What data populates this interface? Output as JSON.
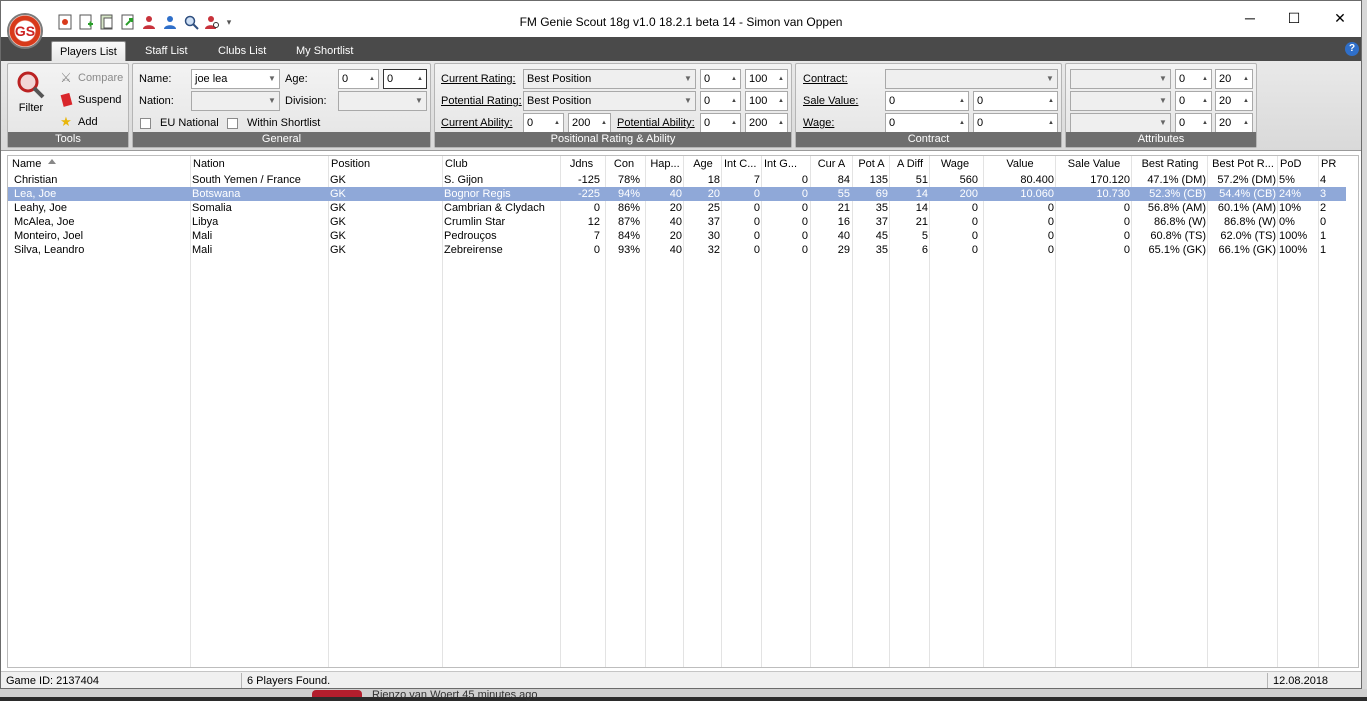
{
  "window": {
    "title": "FM Genie Scout 18g v1.0 18.2.1 beta 14 - Simon van Oppen",
    "logo_text": "GS",
    "quick_access_icons": [
      "new-search-icon",
      "add-page-icon",
      "copy-page-icon",
      "export-page-icon",
      "person-red-icon",
      "person-blue-icon",
      "search-person-icon",
      "person-red-search-icon"
    ],
    "qat_dropdown": "▾",
    "minimize": "─",
    "maximize": "☐",
    "close": "✕"
  },
  "tabs": [
    {
      "label": "Players List",
      "active": true
    },
    {
      "label": "Staff List",
      "active": false
    },
    {
      "label": "Clubs List",
      "active": false
    },
    {
      "label": "My Shortlist",
      "active": false
    }
  ],
  "help_label": "?",
  "tools": {
    "group_label": "Tools",
    "filter_label": "Filter",
    "compare_label": "Compare",
    "suspend_label": "Suspend",
    "add_label": "Add"
  },
  "general": {
    "group_label": "General",
    "name_label": "Name:",
    "name_value": "joe lea",
    "age_label": "Age:",
    "age_min": "0",
    "age_max": "0",
    "nation_label": "Nation:",
    "nation_value": "",
    "division_label": "Division:",
    "division_value": "",
    "eu_label": "EU National",
    "shortlist_label": "Within Shortlist"
  },
  "positional": {
    "group_label": "Positional Rating & Ability",
    "current_rating_label": "Current Rating:",
    "current_rating_value": "Best Position",
    "cr_min": "0",
    "cr_max": "100",
    "potential_rating_label": "Potential Rating:",
    "potential_rating_value": "Best Position",
    "pr_min": "0",
    "pr_max": "100",
    "current_ability_label": "Current Ability:",
    "ca_min": "0",
    "ca_max": "200",
    "potential_ability_label": "Potential Ability:",
    "pa_min": "0",
    "pa_max": "200"
  },
  "contract": {
    "group_label": "Contract",
    "contract_label": "Contract:",
    "contract_value": "",
    "sale_value_label": "Sale Value:",
    "sale_min": "0",
    "sale_max": "0",
    "wage_label": "Wage:",
    "wage_min": "0",
    "wage_max": "0"
  },
  "attributes": {
    "group_label": "Attributes",
    "rows": [
      {
        "value": "",
        "min": "0",
        "max": "20"
      },
      {
        "value": "",
        "min": "0",
        "max": "20"
      },
      {
        "value": "",
        "min": "0",
        "max": "20"
      }
    ]
  },
  "table": {
    "columns": [
      "Name",
      "Nation",
      "Position",
      "Club",
      "Jdns",
      "Con",
      "Hap...",
      "Age",
      "Int C...",
      "Int G...",
      "Cur A",
      "Pot A",
      "A Diff",
      "Wage",
      "Value",
      "Sale Value",
      "Best Rating",
      "Best Pot R...",
      "PoD",
      "PR"
    ],
    "rows": [
      {
        "selected": false,
        "cells": [
          "Christian",
          "South Yemen / France",
          "GK",
          "S. Gijon",
          "-125",
          "78%",
          "80",
          "18",
          "7",
          "0",
          "84",
          "135",
          "51",
          "560",
          "80.400",
          "170.120",
          "47.1% (DM)",
          "57.2% (DM)",
          "5%",
          "4"
        ]
      },
      {
        "selected": true,
        "cells": [
          "Lea, Joe",
          "Botswana",
          "GK",
          "Bognor Regis",
          "-225",
          "94%",
          "40",
          "20",
          "0",
          "0",
          "55",
          "69",
          "14",
          "200",
          "10.060",
          "10.730",
          "52.3% (CB)",
          "54.4% (CB)",
          "24%",
          "3"
        ]
      },
      {
        "selected": false,
        "cells": [
          "Leahy, Joe",
          "Somalia",
          "GK",
          "Cambrian & Clydach",
          "0",
          "86%",
          "20",
          "25",
          "0",
          "0",
          "21",
          "35",
          "14",
          "0",
          "0",
          "0",
          "56.8% (AM)",
          "60.1% (AM)",
          "10%",
          "2"
        ]
      },
      {
        "selected": false,
        "cells": [
          "McAlea, Joe",
          "Libya",
          "GK",
          "Crumlin Star",
          "12",
          "87%",
          "40",
          "37",
          "0",
          "0",
          "16",
          "37",
          "21",
          "0",
          "0",
          "0",
          "86.8% (W)",
          "86.8% (W)",
          "0%",
          "0"
        ]
      },
      {
        "selected": false,
        "cells": [
          "Monteiro, Joel",
          "Mali",
          "GK",
          "Pedrouços",
          "7",
          "84%",
          "20",
          "30",
          "0",
          "0",
          "40",
          "45",
          "5",
          "0",
          "0",
          "0",
          "60.8% (TS)",
          "62.0% (TS)",
          "100%",
          "1"
        ]
      },
      {
        "selected": false,
        "cells": [
          "Silva, Leandro",
          "Mali",
          "GK",
          "Zebreirense",
          "0",
          "93%",
          "40",
          "32",
          "0",
          "0",
          "29",
          "35",
          "6",
          "0",
          "0",
          "0",
          "65.1% (GK)",
          "66.1% (GK)",
          "100%",
          "1"
        ]
      }
    ]
  },
  "status": {
    "game_id": "Game ID: 2137404",
    "found": "6 Players Found.",
    "date": "12.08.2018"
  },
  "background": {
    "text": "Rienzo van Woert  45 minutes ago"
  }
}
